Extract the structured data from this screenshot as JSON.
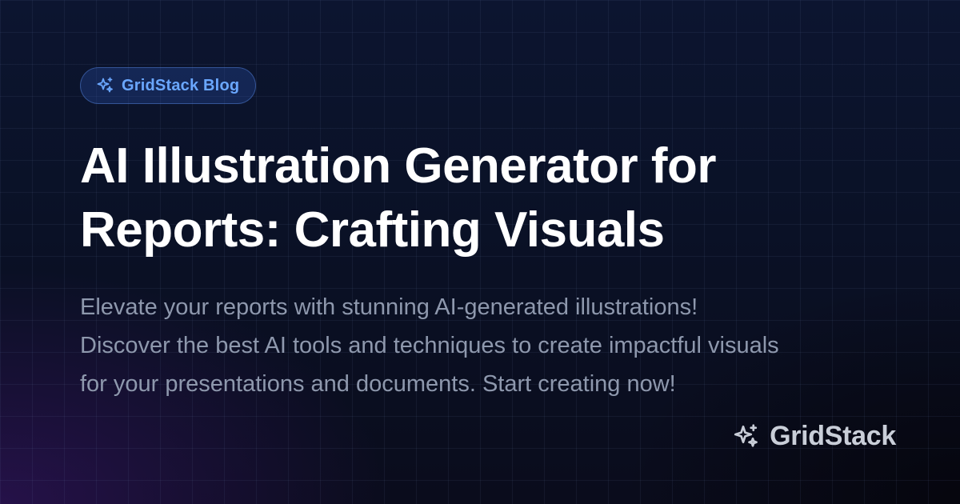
{
  "badge": {
    "icon": "sparkles-icon",
    "label": "GridStack Blog",
    "color": "#6aa7ff"
  },
  "title": "AI Illustration Generator for Reports: Crafting Visuals",
  "description": "Elevate your reports with stunning AI-generated illustrations! Discover the best AI tools and techniques to create impactful visuals for your presentations and documents. Start creating now!",
  "brand": {
    "icon": "sparkles-icon",
    "name": "GridStack"
  },
  "colors": {
    "background": "#0b1228",
    "title": "#ffffff",
    "description": "#8e98ad",
    "brand": "#c9ced8"
  }
}
